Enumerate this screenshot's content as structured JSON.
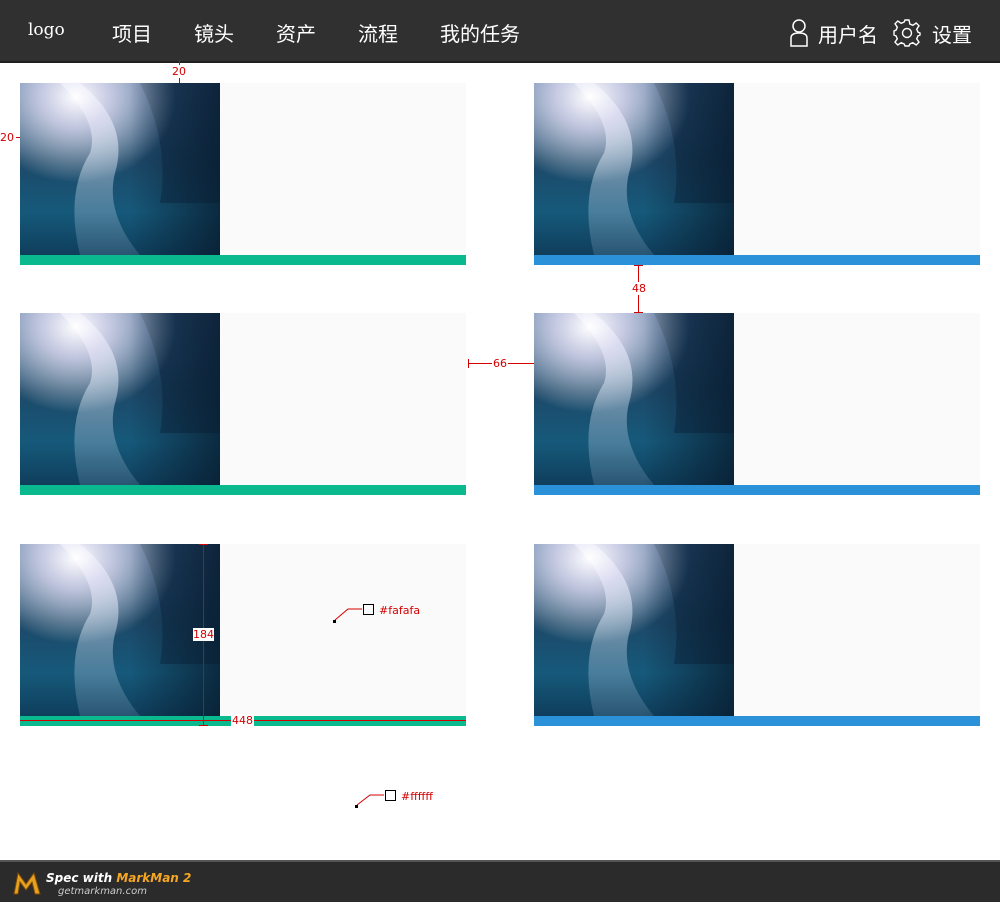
{
  "header": {
    "logo": "logo",
    "nav": [
      "项目",
      "镜头",
      "资产",
      "流程",
      "我的任务"
    ],
    "user_label": "用户名",
    "settings_label": "设置"
  },
  "cards": [
    {
      "accent": "#0bb98f"
    },
    {
      "accent": "#2b92d9"
    },
    {
      "accent": "#0bb98f"
    },
    {
      "accent": "#2b92d9"
    },
    {
      "accent": "#0bb98f"
    },
    {
      "accent": "#2b92d9"
    }
  ],
  "colors": {
    "card_bg": "#fafafa",
    "page_bg": "#ffffff",
    "nav_bg": "#303030"
  },
  "spec": {
    "top_gap": "20",
    "left_gap": "20",
    "row_gap": "48",
    "col_gap": "66",
    "card_height": "184",
    "card_width": "448",
    "card_bg_label": "#fafafa",
    "page_bg_label": "#ffffff"
  },
  "footer": {
    "spec_prefix": "Spec with ",
    "brand": "MarkMan 2",
    "site": "getmarkman.com"
  }
}
